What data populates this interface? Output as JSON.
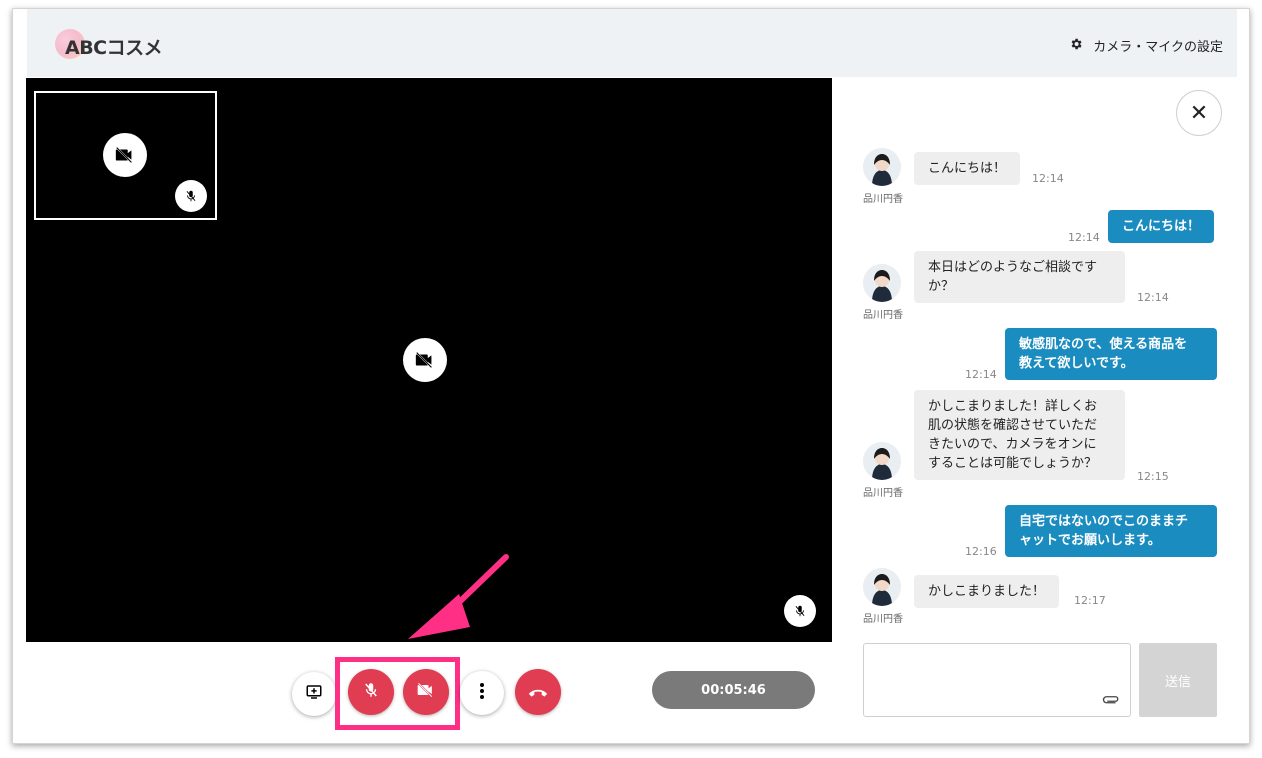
{
  "header": {
    "logo_text": "ABCコスメ",
    "settings_label": "カメラ・マイクの設定",
    "settings_icon": "gear-icon"
  },
  "video": {
    "self_camera_icon": "camera-off-icon",
    "self_mic_icon": "mic-off-icon",
    "main_camera_icon": "camera-off-icon",
    "main_mic_icon": "mic-off-icon"
  },
  "controls": {
    "share_icon": "screen-share-icon",
    "mic_icon": "mic-off-icon",
    "camera_icon": "camera-off-icon",
    "more_icon": "more-vertical-icon",
    "hangup_icon": "phone-hangup-icon",
    "timer": "00:05:46",
    "accent_red": "#e03c52",
    "highlight_color": "#ff2f86"
  },
  "chat": {
    "close_icon": "close-icon",
    "agent_name": "品川円香",
    "messages": [
      {
        "from": "agent",
        "text": "こんにちは！",
        "time": "12:14"
      },
      {
        "from": "user",
        "text": "こんにちは！",
        "time": "12:14"
      },
      {
        "from": "agent",
        "lines": [
          "本日はどのようなご相談です",
          "か？"
        ],
        "time": "12:14"
      },
      {
        "from": "user",
        "lines": [
          "敏感肌なので、使える商品を",
          "教えて欲しいです。"
        ],
        "time": "12:14"
      },
      {
        "from": "agent",
        "lines": [
          "かしこまりました！詳しくお",
          "肌の状態を確認させていただ",
          "きたいので、カメラをオンに",
          "することは可能でしょうか？"
        ],
        "time": "12:15"
      },
      {
        "from": "user",
        "lines": [
          "自宅ではないのでこのままチ",
          "ャットでお願いします。"
        ],
        "time": "12:16"
      },
      {
        "from": "agent",
        "text": "かしこまりました！",
        "time": "12:17"
      }
    ],
    "input_placeholder": "",
    "attach_icon": "paperclip-icon",
    "send_label": "送信",
    "bubble_out_color": "#1b8cbf"
  }
}
